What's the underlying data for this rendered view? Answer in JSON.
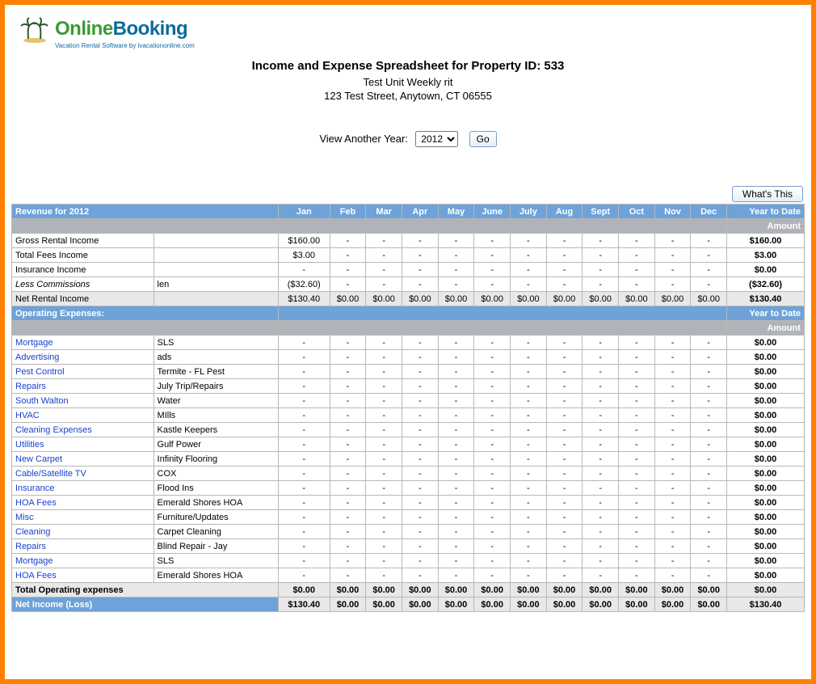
{
  "logo": {
    "text_green": "Online",
    "text_blue": "Booking",
    "subtitle": "Vacation Rental Software by ivacationonline.com"
  },
  "header": {
    "title": "Income and Expense Spreadsheet for Property ID: 533",
    "unit": "Test Unit Weekly rit",
    "address": "123 Test Street, Anytown, CT 06555",
    "year_label": "View Another Year:",
    "year_value": "2012",
    "go_label": "Go",
    "whats_this": "What's This"
  },
  "table": {
    "revenue_header": "Revenue for 2012",
    "months": [
      "Jan",
      "Feb",
      "Mar",
      "Apr",
      "May",
      "June",
      "July",
      "Aug",
      "Sept",
      "Oct",
      "Nov",
      "Dec"
    ],
    "ytd_label": "Year to Date",
    "amount_label": "Amount",
    "revenue_rows": [
      {
        "label": "Gross Rental Income",
        "desc": "",
        "jan": "$160.00",
        "rest": [
          "-",
          "-",
          "-",
          "-",
          "-",
          "-",
          "-",
          "-",
          "-",
          "-",
          "-"
        ],
        "ytd": "$160.00",
        "shade": false
      },
      {
        "label": "Total Fees Income",
        "desc": "",
        "jan": "$3.00",
        "rest": [
          "-",
          "-",
          "-",
          "-",
          "-",
          "-",
          "-",
          "-",
          "-",
          "-",
          "-"
        ],
        "ytd": "$3.00",
        "shade": false
      },
      {
        "label": "Insurance Income",
        "desc": "",
        "jan": "-",
        "rest": [
          "-",
          "-",
          "-",
          "-",
          "-",
          "-",
          "-",
          "-",
          "-",
          "-",
          "-"
        ],
        "ytd": "$0.00",
        "shade": false
      },
      {
        "label": "Less Commissions",
        "desc": "len",
        "jan": "($32.60)",
        "rest": [
          "-",
          "-",
          "-",
          "-",
          "-",
          "-",
          "-",
          "-",
          "-",
          "-",
          "-"
        ],
        "ytd": "($32.60)",
        "italic": true,
        "shade": false
      },
      {
        "label": "Net Rental Income",
        "desc": "",
        "jan": "$130.40",
        "rest": [
          "$0.00",
          "$0.00",
          "$0.00",
          "$0.00",
          "$0.00",
          "$0.00",
          "$0.00",
          "$0.00",
          "$0.00",
          "$0.00",
          "$0.00"
        ],
        "ytd": "$130.40",
        "shade": true
      }
    ],
    "expenses_header": "Operating Expenses:",
    "expense_rows": [
      {
        "label": "Mortgage",
        "desc": "SLS",
        "ytd": "$0.00"
      },
      {
        "label": "Advertising",
        "desc": "ads",
        "ytd": "$0.00"
      },
      {
        "label": "Pest Control",
        "desc": "Termite - FL Pest",
        "ytd": "$0.00"
      },
      {
        "label": "Repairs",
        "desc": "July Trip/Repairs",
        "ytd": "$0.00"
      },
      {
        "label": "South Walton",
        "desc": "Water",
        "ytd": "$0.00"
      },
      {
        "label": "HVAC",
        "desc": "MIlls",
        "ytd": "$0.00"
      },
      {
        "label": "Cleaning Expenses",
        "desc": "Kastle Keepers",
        "ytd": "$0.00"
      },
      {
        "label": "Utilities",
        "desc": "Gulf Power",
        "ytd": "$0.00"
      },
      {
        "label": "New Carpet",
        "desc": "Infinity Flooring",
        "ytd": "$0.00"
      },
      {
        "label": "Cable/Satellite TV",
        "desc": "COX",
        "ytd": "$0.00"
      },
      {
        "label": "Insurance",
        "desc": "Flood Ins",
        "ytd": "$0.00"
      },
      {
        "label": "HOA Fees",
        "desc": "Emerald Shores HOA",
        "ytd": "$0.00"
      },
      {
        "label": "Misc",
        "desc": "Furniture/Updates",
        "ytd": "$0.00"
      },
      {
        "label": "Cleaning",
        "desc": "Carpet Cleaning",
        "ytd": "$0.00"
      },
      {
        "label": "Repairs",
        "desc": "Blind Repair - Jay",
        "ytd": "$0.00"
      },
      {
        "label": "Mortgage",
        "desc": "SLS",
        "ytd": "$0.00"
      },
      {
        "label": "HOA Fees",
        "desc": "Emerald Shores HOA",
        "ytd": "$0.00"
      }
    ],
    "total_exp_label": "Total Operating expenses",
    "total_exp_vals": [
      "$0.00",
      "$0.00",
      "$0.00",
      "$0.00",
      "$0.00",
      "$0.00",
      "$0.00",
      "$0.00",
      "$0.00",
      "$0.00",
      "$0.00",
      "$0.00"
    ],
    "total_exp_ytd": "$0.00",
    "net_income_label": "Net Income (Loss)",
    "net_income_vals": [
      "$130.40",
      "$0.00",
      "$0.00",
      "$0.00",
      "$0.00",
      "$0.00",
      "$0.00",
      "$0.00",
      "$0.00",
      "$0.00",
      "$0.00",
      "$0.00"
    ],
    "net_income_ytd": "$130.40"
  }
}
